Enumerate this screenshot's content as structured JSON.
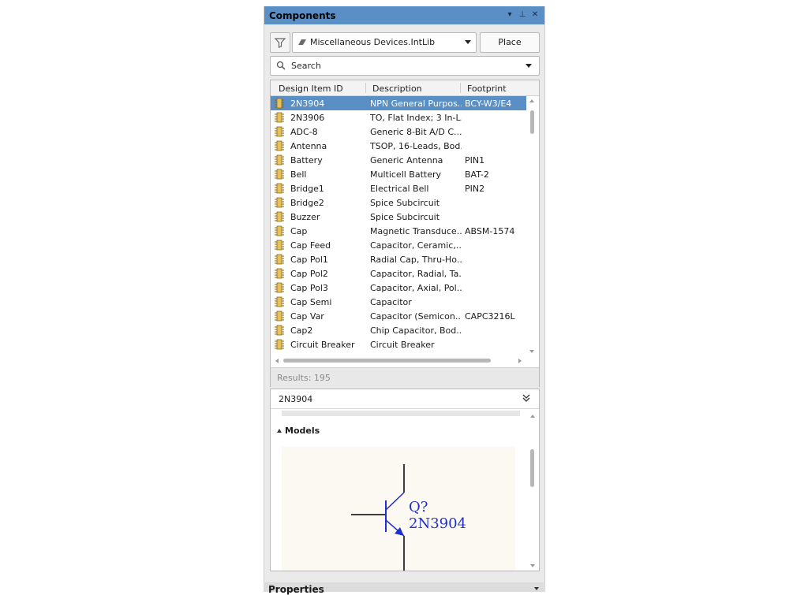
{
  "panel": {
    "title": "Components",
    "controls": {
      "menu": "▾",
      "pin": "⊥",
      "close": "✕"
    }
  },
  "toolbar": {
    "library": "Miscellaneous Devices.IntLib",
    "place_label": "Place"
  },
  "search": {
    "placeholder": "Search"
  },
  "table": {
    "columns": [
      "Design Item ID",
      "Description",
      "Footprint"
    ],
    "rows": [
      {
        "id": "2N3904",
        "desc": "NPN General Purpos...",
        "fp": "BCY-W3/E4",
        "selected": true
      },
      {
        "id": "2N3906",
        "desc": "TO, Flat Index; 3 In-L...",
        "fp": ""
      },
      {
        "id": "ADC-8",
        "desc": "Generic 8-Bit A/D C...",
        "fp": ""
      },
      {
        "id": "Antenna",
        "desc": "TSOP, 16-Leads, Bod...",
        "fp": ""
      },
      {
        "id": "Battery",
        "desc": "Generic Antenna",
        "fp": "PIN1"
      },
      {
        "id": "Bell",
        "desc": "Multicell Battery",
        "fp": "BAT-2"
      },
      {
        "id": "Bridge1",
        "desc": "Electrical Bell",
        "fp": "PIN2"
      },
      {
        "id": "Bridge2",
        "desc": "Spice Subcircuit",
        "fp": ""
      },
      {
        "id": "Buzzer",
        "desc": "Spice Subcircuit",
        "fp": ""
      },
      {
        "id": "Cap",
        "desc": "Magnetic Transduce...",
        "fp": "ABSM-1574"
      },
      {
        "id": "Cap Feed",
        "desc": "Capacitor, Ceramic,...",
        "fp": ""
      },
      {
        "id": "Cap Pol1",
        "desc": "Radial Cap, Thru-Ho...",
        "fp": ""
      },
      {
        "id": "Cap Pol2",
        "desc": "Capacitor, Radial, Ta...",
        "fp": ""
      },
      {
        "id": "Cap Pol3",
        "desc": "Capacitor, Axial, Pol...",
        "fp": ""
      },
      {
        "id": "Cap Semi",
        "desc": "Capacitor",
        "fp": ""
      },
      {
        "id": "Cap Var",
        "desc": "Capacitor (Semicon...",
        "fp": "CAPC3216L"
      },
      {
        "id": "Cap2",
        "desc": "Chip Capacitor, Bod...",
        "fp": ""
      },
      {
        "id": "Circuit Breaker",
        "desc": "Circuit Breaker",
        "fp": ""
      }
    ],
    "results": "Results: 195"
  },
  "details": {
    "name": "2N3904",
    "models_label": "Models",
    "symbol": {
      "designator": "Q?",
      "comment": "2N3904",
      "color": "#1f2fd0"
    }
  },
  "properties_label": "Properties",
  "colors": {
    "title_bar": "#5a8fc6",
    "selection": "#5a8fc6",
    "arrow": "#e8262b"
  }
}
